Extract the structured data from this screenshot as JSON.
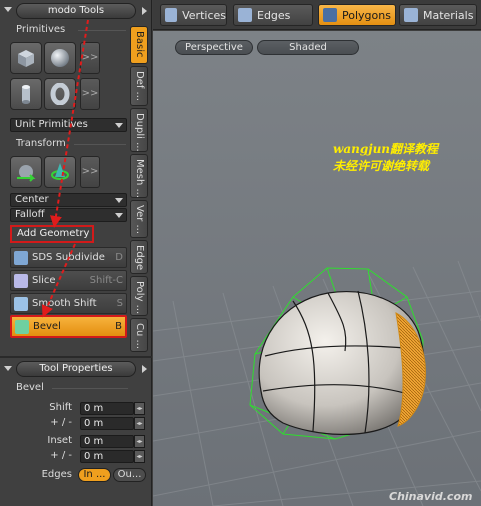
{
  "left_panel": {
    "title": "modo Tools",
    "primitives": {
      "label": "Primitives",
      "more": ">>",
      "dropdown": "Unit Primitives"
    },
    "transform": {
      "label": "Transform",
      "more": ">>",
      "center": "Center",
      "falloff": "Falloff"
    },
    "add_geometry": {
      "label": "Add Geometry"
    },
    "tools": [
      {
        "label": "SDS Subdivide",
        "key": "D",
        "icon_color": "#7fa7d4"
      },
      {
        "label": "Slice",
        "key": "Shift-C",
        "icon_color": "#b9b9e8"
      },
      {
        "label": "Smooth Shift",
        "key": "S",
        "icon_color": "#9cc2e6"
      },
      {
        "label": "Bevel",
        "key": "B",
        "icon_color": "#6fd0a0",
        "selected": true
      }
    ],
    "vertical_tabs": [
      "Basic",
      "Def ...",
      "Dupli ...",
      "Mesh ...",
      "Ver ...",
      "Edge",
      "Poly ...",
      "Cu ..."
    ],
    "tool_properties": {
      "title": "Tool Properties",
      "section": "Bevel",
      "shift_label": "Shift",
      "shift_value": "0 m",
      "shift_pm_label": "+ / -",
      "shift_pm_value": "0 m",
      "inset_label": "Inset",
      "inset_value": "0 m",
      "inset_pm_label": "+ / -",
      "inset_pm_value": "0 m",
      "edges_label": "Edges",
      "edges_options": [
        "In ...",
        "Ou..."
      ],
      "edges_selected": "In ..."
    }
  },
  "toolbar": {
    "modes": [
      {
        "label": "Vertices",
        "active": false
      },
      {
        "label": "Edges",
        "active": false
      },
      {
        "label": "Polygons",
        "active": true
      },
      {
        "label": "Materials",
        "active": false
      }
    ]
  },
  "viewport": {
    "view_label": "Perspective",
    "shading_label": "Shaded",
    "watermark_line1": "wangjun翻译教程",
    "watermark_line2": "未经许可谢绝转载",
    "credit": "Chinavid.com"
  },
  "colors": {
    "accent_orange": "#f0a020",
    "highlight_red": "#d21a1a",
    "cage_green": "#33dd33"
  }
}
